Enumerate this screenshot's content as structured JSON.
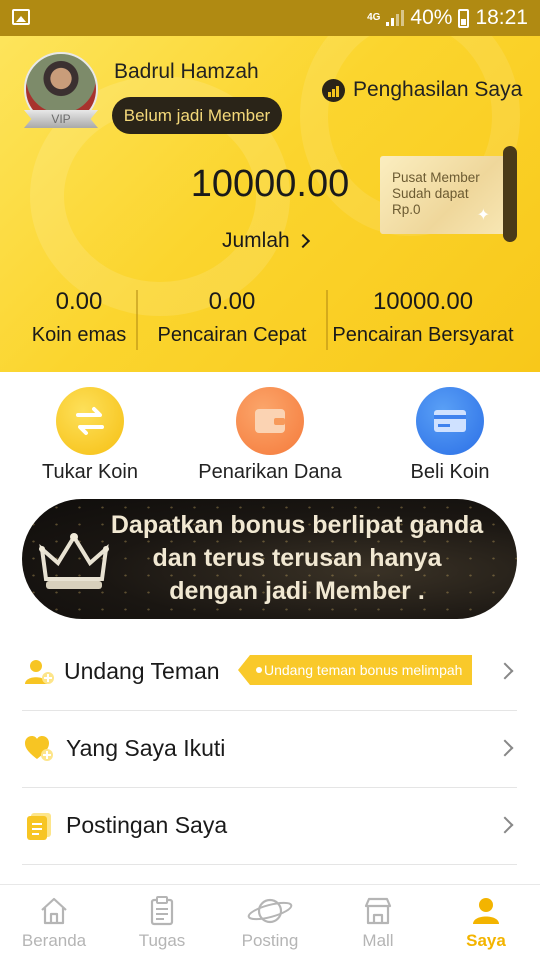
{
  "status_bar": {
    "network": "4G",
    "battery": "40%",
    "time": "18:21"
  },
  "profile": {
    "name": "Badrul Hamzah",
    "vip_label": "VIP",
    "member_status": "Belum jadi Member",
    "income_link": "Penghasilan Saya"
  },
  "balance": {
    "amount": "10000.00",
    "total_label": "Jumlah"
  },
  "member_card": {
    "line1": "Pusat Member",
    "line2": "Sudah dapat",
    "line3": "Rp.0"
  },
  "stats": [
    {
      "value": "0.00",
      "label": "Koin emas"
    },
    {
      "value": "0.00",
      "label": "Pencairan Cepat"
    },
    {
      "value": "10000.00",
      "label": "Pencairan Bersyarat"
    }
  ],
  "actions": [
    {
      "label": "Tukar Koin",
      "icon": "exchange-icon"
    },
    {
      "label": "Penarikan Dana",
      "icon": "wallet-icon"
    },
    {
      "label": "Beli Koin",
      "icon": "card-icon"
    }
  ],
  "banner": {
    "line1": "Dapatkan bonus berlipat ganda",
    "line2": "dan terus terusan hanya",
    "line3": "dengan jadi Member ."
  },
  "menu": [
    {
      "label": "Undang Teman",
      "icon": "invite-user-icon",
      "tag": "Undang teman bonus melimpah"
    },
    {
      "label": "Yang Saya Ikuti",
      "icon": "heart-plus-icon"
    },
    {
      "label": "Postingan Saya",
      "icon": "document-icon"
    }
  ],
  "bottom_nav": [
    {
      "label": "Beranda",
      "icon": "home-icon"
    },
    {
      "label": "Tugas",
      "icon": "clipboard-icon"
    },
    {
      "label": "Posting",
      "icon": "planet-icon"
    },
    {
      "label": "Mall",
      "icon": "store-icon"
    },
    {
      "label": "Saya",
      "icon": "user-icon",
      "active": true
    }
  ],
  "colors": {
    "accent": "#f9c92a",
    "nav_active": "#f3b400",
    "dark_badge": "#2a2418"
  }
}
